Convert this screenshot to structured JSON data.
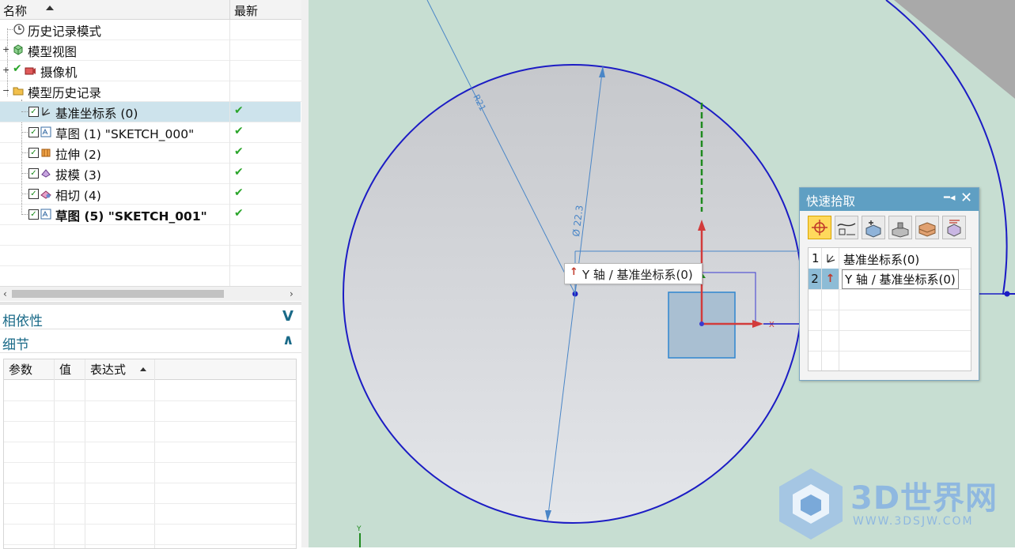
{
  "navigator": {
    "col_name": "名称",
    "col_latest": "最新",
    "items": [
      {
        "label": "历史记录模式",
        "expander": "",
        "icon": "clock-icon",
        "checked": false,
        "latest": ""
      },
      {
        "label": "模型视图",
        "expander": "+",
        "icon": "model-view-icon",
        "checked": false,
        "latest": ""
      },
      {
        "label": "摄像机",
        "expander": "+",
        "icon": "camera-icon",
        "checked": false,
        "latest": ""
      },
      {
        "label": "模型历史记录",
        "expander": "−",
        "icon": "folder-open-icon",
        "checked": false,
        "latest": ""
      },
      {
        "label": "基准坐标系 (0)",
        "icon": "datum-csys-icon",
        "checked": true,
        "latest": "✔"
      },
      {
        "label": "草图 (1) \"SKETCH_000\"",
        "icon": "sketch-icon",
        "checked": true,
        "latest": "✔"
      },
      {
        "label": "拉伸 (2)",
        "icon": "extrude-icon",
        "checked": true,
        "latest": "✔"
      },
      {
        "label": "拔模 (3)",
        "icon": "draft-icon",
        "checked": true,
        "latest": "✔"
      },
      {
        "label": "相切 (4)",
        "icon": "tangent-icon",
        "checked": true,
        "latest": "✔"
      },
      {
        "label": "草图 (5) \"SKETCH_001\"",
        "icon": "sketch-icon",
        "checked": true,
        "latest": "✔"
      }
    ],
    "dependencies_title": "相依性",
    "details_title": "细节",
    "details_columns": [
      "参数",
      "值",
      "表达式"
    ]
  },
  "quick_pick": {
    "title": "快速拾取",
    "pin_icon": "pin-icon",
    "close_icon": "close-icon",
    "filters": [
      "select-all-icon",
      "curve-filter-icon",
      "body-filter-icon",
      "face-filter-icon",
      "feature-filter-icon",
      "component-filter-icon"
    ],
    "items": [
      {
        "num": "1",
        "icon": "datum-csys-icon",
        "label": "基准坐标系(0)"
      },
      {
        "num": "2",
        "icon": "y-axis-icon",
        "label": "Y 轴 / 基准坐标系(0)"
      }
    ]
  },
  "graphics": {
    "tooltip": "Y 轴 / 基准坐标系(0)",
    "dimension_diameter": "Ø 22.3",
    "dimension_radius": "R21",
    "axis_x_label": "X",
    "axis_y_label": "Y",
    "colors": {
      "background": "#c7ded2",
      "circle_fill": "#d3d7dc",
      "circle_edge": "#1c1cc4",
      "dimension": "#4a86c7",
      "axis_red": "#d23b3b",
      "axis_green": "#1f8a1f"
    }
  },
  "watermark": {
    "brand": "3D世界网",
    "url": "WWW.3DSJW.COM"
  }
}
